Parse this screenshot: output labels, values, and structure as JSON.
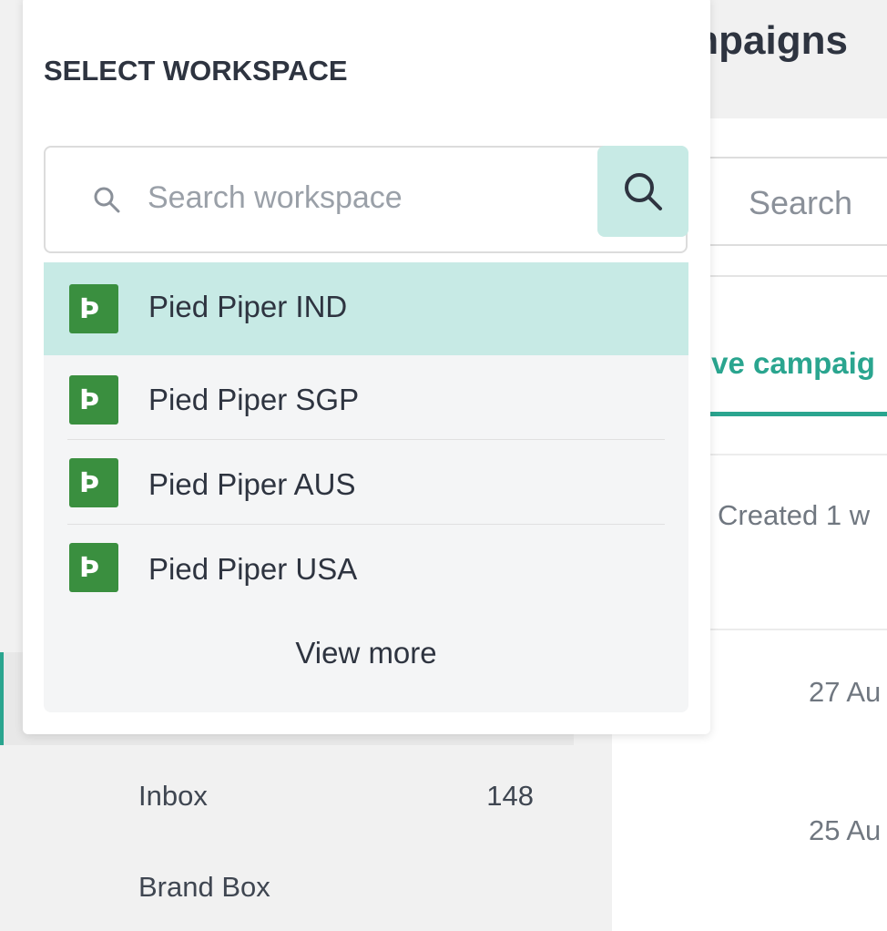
{
  "popup": {
    "title": "SELECT WORKSPACE",
    "search_placeholder": "Search workspace",
    "search_value": "",
    "workspaces": [
      {
        "label": "Pied Piper IND",
        "selected": true
      },
      {
        "label": "Pied Piper SGP",
        "selected": false
      },
      {
        "label": "Pied Piper AUS",
        "selected": false
      },
      {
        "label": "Pied Piper USA",
        "selected": false
      }
    ],
    "view_more_label": "View more",
    "accent_color": "#c7eae5",
    "logo_color": "#3a8f3f"
  },
  "sidebar": {
    "items": [
      {
        "label": "Inbox",
        "count": "148"
      },
      {
        "label": "Brand Box",
        "count": ""
      }
    ]
  },
  "main": {
    "title": "mpaigns",
    "search_placeholder": "Search",
    "active_tab": "ive campaig",
    "column_header": "Created 1 w",
    "rows": [
      {
        "date": "27 Au"
      },
      {
        "date": "25 Au"
      }
    ],
    "accent_color": "#2aa58f"
  }
}
